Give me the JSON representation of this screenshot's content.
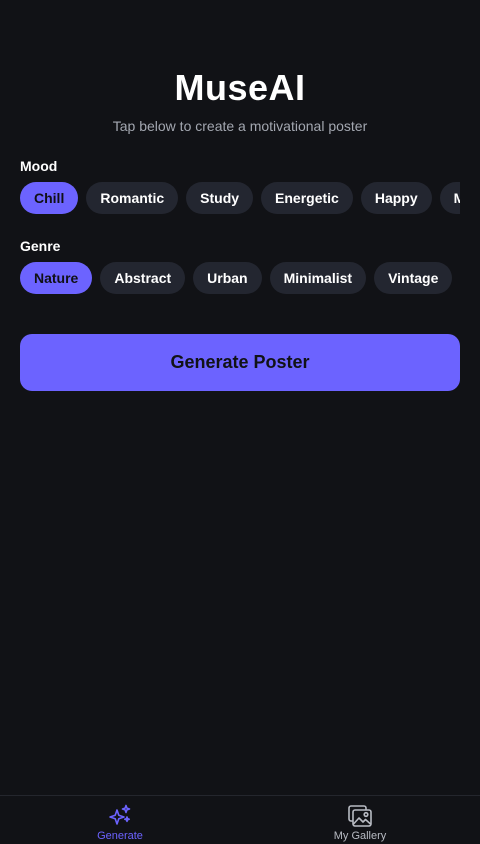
{
  "app": {
    "title": "MuseAI",
    "subtitle": "Tap below to create a motivational poster"
  },
  "mood": {
    "label": "Mood",
    "options": [
      "Chill",
      "Romantic",
      "Study",
      "Energetic",
      "Happy",
      "M"
    ],
    "selected": "Chill"
  },
  "genre": {
    "label": "Genre",
    "options": [
      "Nature",
      "Abstract",
      "Urban",
      "Minimalist",
      "Vintage"
    ],
    "selected": "Nature"
  },
  "generate_button": {
    "label": "Generate Poster"
  },
  "tabbar": {
    "tabs": [
      {
        "label": "Generate",
        "icon": "sparkles-icon",
        "active": true
      },
      {
        "label": "My Gallery",
        "icon": "image-gallery-icon",
        "active": false
      }
    ]
  },
  "colors": {
    "background": "#111216",
    "accent": "#6c63ff",
    "chip": "#232630",
    "muted_text": "#a3a7b0"
  }
}
